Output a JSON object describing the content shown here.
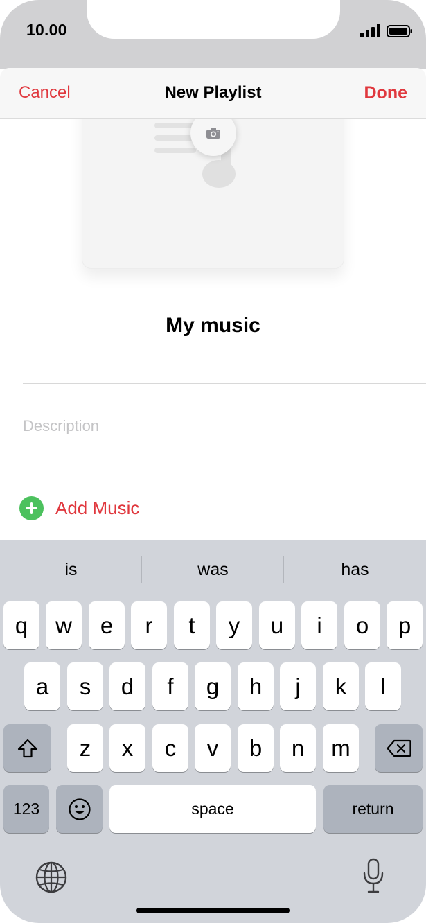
{
  "status_bar": {
    "time": "10.00"
  },
  "navbar": {
    "cancel_label": "Cancel",
    "title": "New Playlist",
    "done_label": "Done"
  },
  "playlist": {
    "name": "My music",
    "description_placeholder": "Description"
  },
  "add_music": {
    "label": "Add Music"
  },
  "keyboard": {
    "suggestions": [
      "is",
      "was",
      "has"
    ],
    "row1": [
      "q",
      "w",
      "e",
      "r",
      "t",
      "y",
      "u",
      "i",
      "o",
      "p"
    ],
    "row2": [
      "a",
      "s",
      "d",
      "f",
      "g",
      "h",
      "j",
      "k",
      "l"
    ],
    "row3": [
      "z",
      "x",
      "c",
      "v",
      "b",
      "n",
      "m"
    ],
    "numbers_label": "123",
    "space_label": "space",
    "return_label": "return"
  },
  "colors": {
    "accent": "#e0383e",
    "add_green": "#4cc15e",
    "keyboard_bg": "#d1d4da"
  }
}
